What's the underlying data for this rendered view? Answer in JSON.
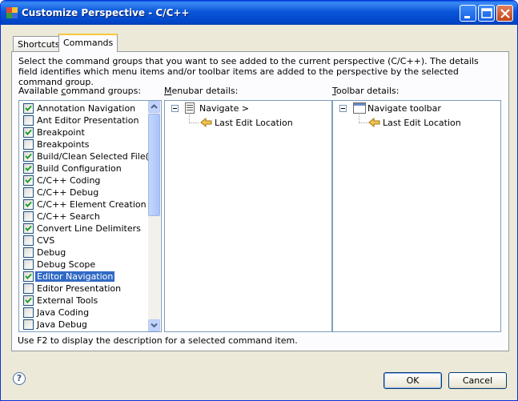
{
  "window": {
    "title": "Customize Perspective - C/C++"
  },
  "tabs": [
    {
      "label": "Shortcuts"
    },
    {
      "label": "Commands"
    }
  ],
  "description": "Select the command groups that you want to see added to the current perspective (C/C++).  The details field identifies which menu items and/or toolbar items are added to the perspective by the selected command group.",
  "labels": {
    "available_pre": "Available ",
    "available_u": "c",
    "available_post": "ommand groups:",
    "menubar_u": "M",
    "menubar_post": "enubar details:",
    "toolbar_u": "T",
    "toolbar_post": "oolbar details:"
  },
  "command_groups": [
    {
      "label": "Annotation Navigation",
      "checked": true
    },
    {
      "label": "Ant Editor Presentation",
      "checked": false
    },
    {
      "label": "Breakpoint",
      "checked": true
    },
    {
      "label": "Breakpoints",
      "checked": false
    },
    {
      "label": "Build/Clean Selected File(s)",
      "checked": true
    },
    {
      "label": "Build Configuration",
      "checked": true
    },
    {
      "label": "C/C++ Coding",
      "checked": true
    },
    {
      "label": "C/C++ Debug",
      "checked": false
    },
    {
      "label": "C/C++ Element Creation",
      "checked": true
    },
    {
      "label": "C/C++ Search",
      "checked": false
    },
    {
      "label": "Convert Line Delimiters",
      "checked": true
    },
    {
      "label": "CVS",
      "checked": false
    },
    {
      "label": "Debug",
      "checked": false
    },
    {
      "label": "Debug Scope",
      "checked": false
    },
    {
      "label": "Editor Navigation",
      "checked": true
    },
    {
      "label": "Editor Presentation",
      "checked": false
    },
    {
      "label": "External Tools",
      "checked": true
    },
    {
      "label": "Java Coding",
      "checked": false
    },
    {
      "label": "Java Debug",
      "checked": false
    }
  ],
  "menubar_tree": {
    "root": "Navigate  >",
    "child": "Last Edit Location"
  },
  "toolbar_tree": {
    "root": "Navigate toolbar",
    "child": "Last Edit Location"
  },
  "status": "Use F2 to display the description for a selected command item.",
  "buttons": {
    "ok": "OK",
    "cancel": "Cancel",
    "help": "?"
  }
}
